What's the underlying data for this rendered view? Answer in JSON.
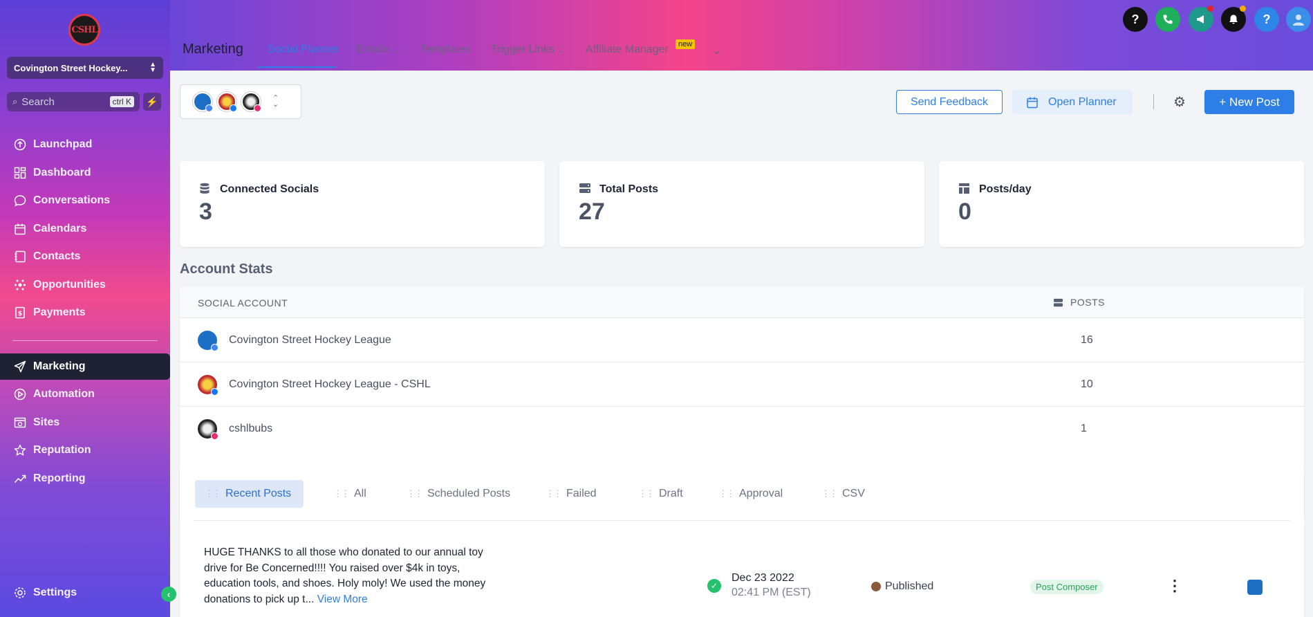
{
  "sidebar": {
    "logo_text": "CSHL",
    "account_name": "Covington Street Hockey...",
    "search_placeholder": "Search",
    "search_shortcut": "ctrl K",
    "items": [
      {
        "label": "Launchpad",
        "icon": "launchpad-icon"
      },
      {
        "label": "Dashboard",
        "icon": "dashboard-icon"
      },
      {
        "label": "Conversations",
        "icon": "chat-icon"
      },
      {
        "label": "Calendars",
        "icon": "calendar-icon"
      },
      {
        "label": "Contacts",
        "icon": "contacts-icon"
      },
      {
        "label": "Opportunities",
        "icon": "opportunities-icon"
      },
      {
        "label": "Payments",
        "icon": "payments-icon"
      },
      {
        "label": "Marketing",
        "icon": "send-icon",
        "active": true
      },
      {
        "label": "Automation",
        "icon": "automation-icon"
      },
      {
        "label": "Sites",
        "icon": "sites-icon"
      },
      {
        "label": "Reputation",
        "icon": "star-icon"
      },
      {
        "label": "Reporting",
        "icon": "reporting-icon"
      }
    ],
    "settings_label": "Settings"
  },
  "header": {
    "title": "Marketing",
    "tabs": [
      {
        "label": "Social Planner",
        "active": true
      },
      {
        "label": "Emails",
        "dropdown": true
      },
      {
        "label": "Templates"
      },
      {
        "label": "Trigger Links",
        "dropdown": true
      },
      {
        "label": "Affiliate Manager"
      }
    ],
    "new_badge": "new"
  },
  "toolbar": {
    "send_feedback": "Send Feedback",
    "open_planner": "Open Planner",
    "new_post": "+ New Post"
  },
  "stats": [
    {
      "label": "Connected Socials",
      "value": "3",
      "icon": "database-icon"
    },
    {
      "label": "Total Posts",
      "value": "27",
      "icon": "server-icon"
    },
    {
      "label": "Posts/day",
      "value": "0",
      "icon": "layout-icon"
    }
  ],
  "account_stats": {
    "title": "Account Stats",
    "col_account": "SOCIAL ACCOUNT",
    "col_posts": "POSTS",
    "rows": [
      {
        "name": "Covington Street Hockey League",
        "posts": "16",
        "network": "google-business"
      },
      {
        "name": "Covington Street Hockey League - CSHL",
        "posts": "10",
        "network": "facebook"
      },
      {
        "name": "cshlbubs",
        "posts": "1",
        "network": "instagram"
      }
    ]
  },
  "posts": {
    "tabs": [
      "Recent Posts",
      "All",
      "Scheduled Posts",
      "Failed",
      "Draft",
      "Approval",
      "CSV"
    ],
    "items": [
      {
        "text": "HUGE THANKS to all those who donated to our annual toy drive for Be Concerned!!!! You raised over $4k in toys, education tools, and shoes. Holy moly! We used the money donations to pick up t...",
        "view_more": "View More",
        "date": "Dec 23 2022",
        "time": "02:41 PM (EST)",
        "status": "Published",
        "source": "Post Composer"
      }
    ]
  },
  "colors": {
    "accent": "#2d7ee6",
    "success": "#25c26e",
    "sidebar_active": "#1f2233"
  }
}
